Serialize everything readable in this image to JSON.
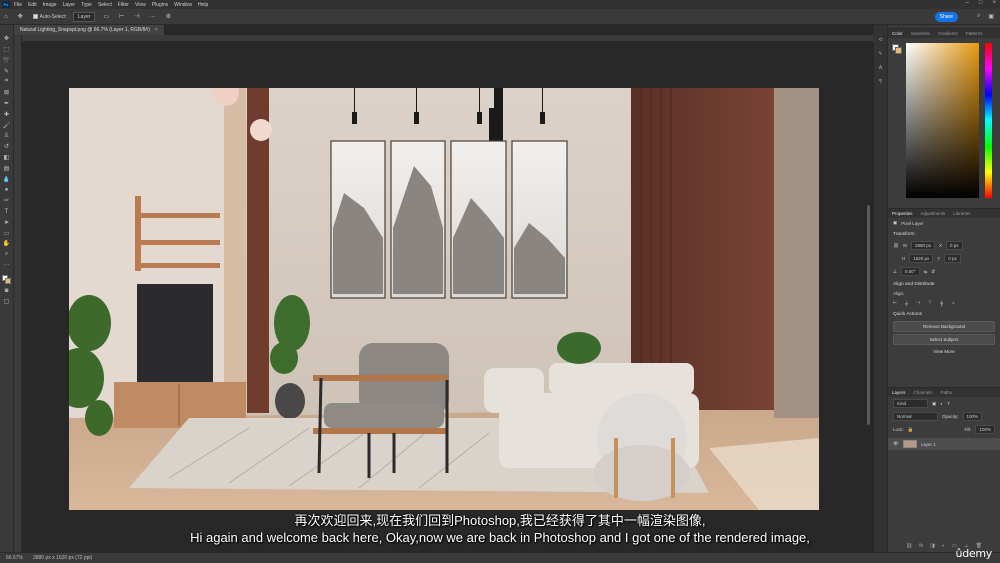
{
  "app": {
    "badge": "Ps"
  },
  "menu": [
    "File",
    "Edit",
    "Image",
    "Layer",
    "Type",
    "Select",
    "Filter",
    "View",
    "Plugins",
    "Window",
    "Help"
  ],
  "window_buttons": [
    "–",
    "□",
    "×"
  ],
  "options_bar": {
    "home_icon": "home-icon",
    "move_icon": "move-tool-icon",
    "auto_select_label": "Auto-Select:",
    "auto_select_target": "Layer",
    "share_label": "Share"
  },
  "document": {
    "tab_title": "Natural Lighting_Snapspt.png @ 66.7% (Layer 1, RGB/8#)",
    "tab_close": "×"
  },
  "status": {
    "zoom": "66.67%",
    "dimensions": "2880 px x 1620 px (72 ppi)"
  },
  "tools": [
    "move",
    "marquee",
    "lasso",
    "quick-select",
    "crop",
    "frame",
    "eyedropper",
    "spot-heal",
    "brush",
    "stamp",
    "history-brush",
    "eraser",
    "gradient",
    "blur",
    "dodge",
    "pen",
    "type",
    "path-select",
    "rectangle",
    "hand",
    "zoom",
    "more"
  ],
  "color_panel": {
    "tabs": [
      "Color",
      "Swatches",
      "Gradients",
      "Patterns"
    ]
  },
  "properties_panel": {
    "tabs": [
      "Properties",
      "Adjustments",
      "Libraries"
    ],
    "layer_type": "Pixel Layer",
    "transform_title": "Transform",
    "w": "2880 px",
    "h": "1620 px",
    "x": "0 px",
    "y": "0 px",
    "angle": "0.00°",
    "align_title": "Align and Distribute",
    "align_label": "Align:",
    "quick_actions_title": "Quick Actions",
    "remove_bg": "Remove Background",
    "select_subject": "Select Subject",
    "see_more": "View More"
  },
  "layers_panel": {
    "tabs": [
      "Layers",
      "Channels",
      "Paths"
    ],
    "kind": "Kind",
    "blend": "Normal",
    "opacity_label": "Opacity:",
    "opacity": "100%",
    "lock_label": "Lock:",
    "fill_label": "Fill:",
    "fill": "100%",
    "layer_name": "Layer 1"
  },
  "subtitles": {
    "zh": "再次欢迎回来,现在我们回到Photoshop,我已经获得了其中一幅渲染图像,",
    "en": "Hi again and welcome back here, Okay,now we are back in Photoshop and I got one of the rendered image,"
  },
  "watermark": "ûdemy"
}
